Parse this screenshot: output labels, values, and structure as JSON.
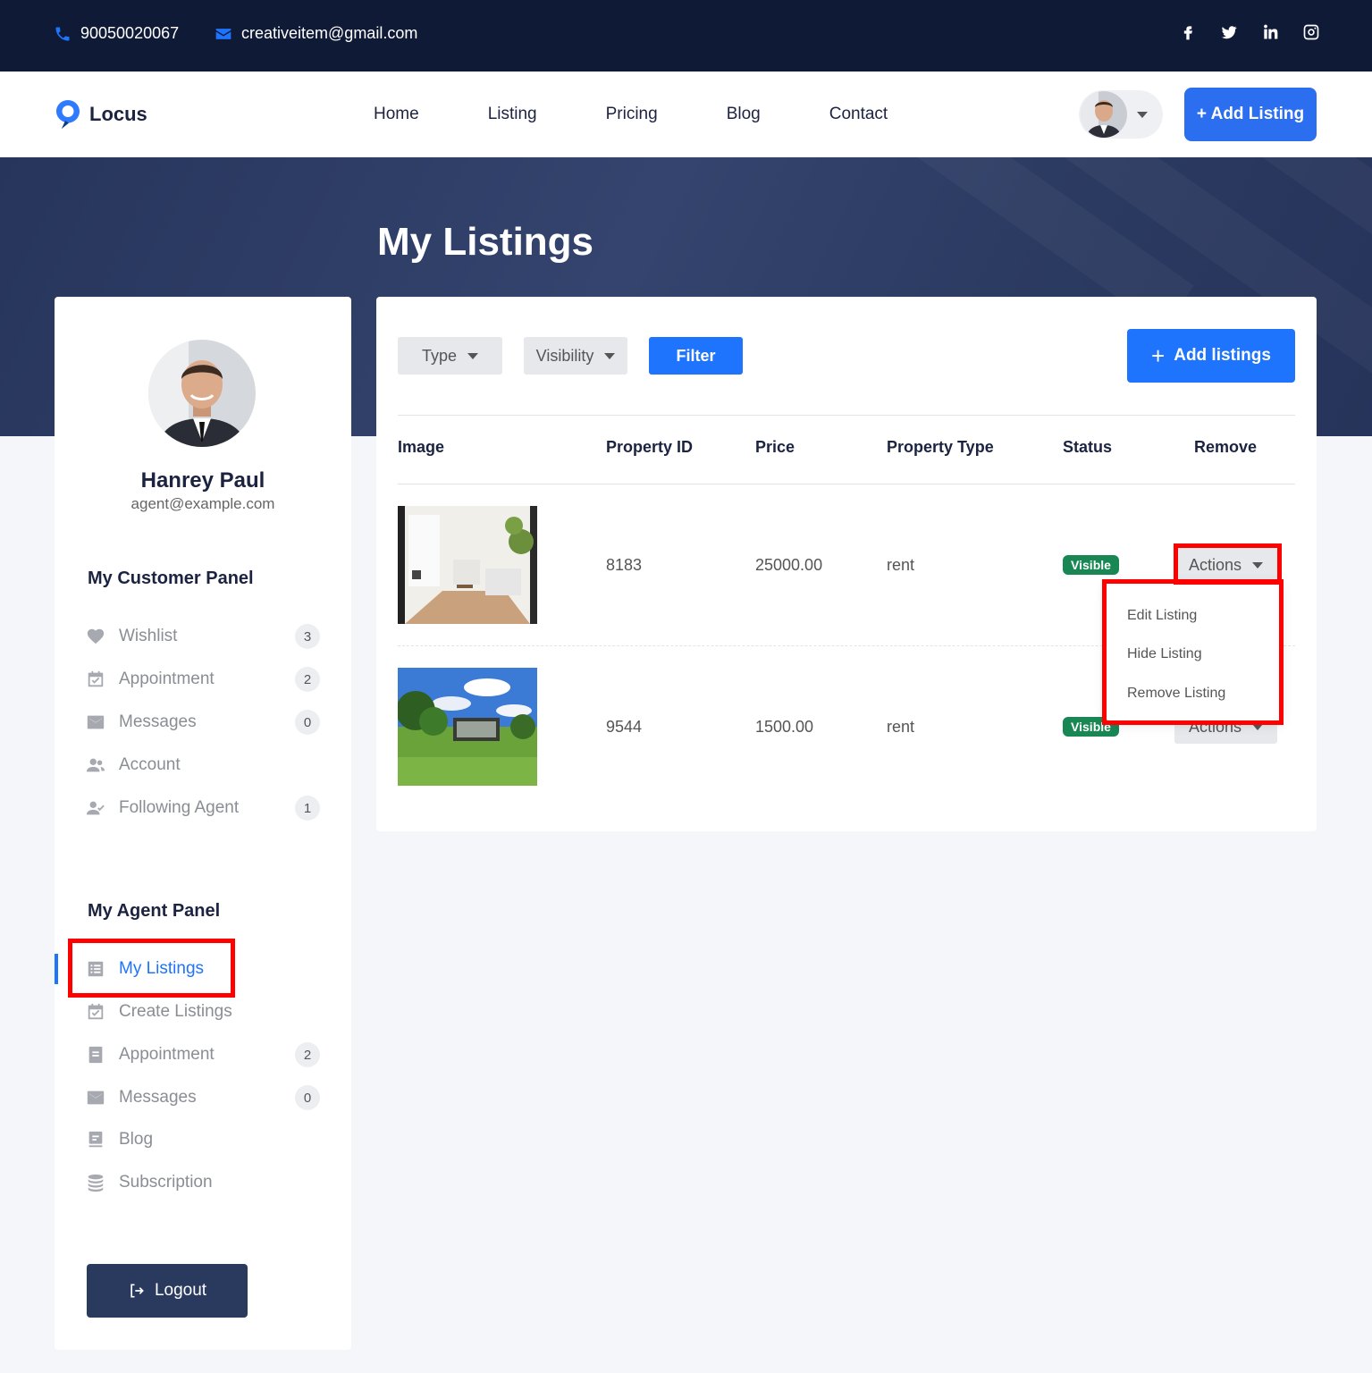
{
  "topbar": {
    "phone": "90050020067",
    "email": "creativeitem@gmail.com",
    "social": [
      "facebook-icon",
      "twitter-icon",
      "linkedin-icon",
      "instagram-icon"
    ]
  },
  "nav": {
    "brand": "Locus",
    "menu": [
      "Home",
      "Listing",
      "Pricing",
      "Blog",
      "Contact"
    ],
    "add_listing": "+ Add Listing"
  },
  "hero": {
    "title": "My Listings"
  },
  "profile": {
    "name": "Hanrey Paul",
    "email": "agent@example.com"
  },
  "customer_panel": {
    "title": "My Customer Panel",
    "items": [
      {
        "label": "Wishlist",
        "count": "3",
        "icon": "heart-icon"
      },
      {
        "label": "Appointment",
        "count": "2",
        "icon": "calendar-check-icon"
      },
      {
        "label": "Messages",
        "count": "0",
        "icon": "envelope-icon"
      },
      {
        "label": "Account",
        "icon": "users-icon"
      },
      {
        "label": "Following Agent",
        "count": "1",
        "icon": "user-check-icon"
      }
    ]
  },
  "agent_panel": {
    "title": "My Agent Panel",
    "items": [
      {
        "label": "My Listings",
        "icon": "list-icon",
        "active": true
      },
      {
        "label": "Create Listings",
        "icon": "calendar-check-icon"
      },
      {
        "label": "Appointment",
        "count": "2",
        "icon": "file-text-icon"
      },
      {
        "label": "Messages",
        "count": "0",
        "icon": "envelope-icon"
      },
      {
        "label": "Blog",
        "icon": "blog-icon"
      },
      {
        "label": "Subscription",
        "icon": "coins-icon"
      }
    ]
  },
  "logout": "Logout",
  "filters": {
    "type": "Type",
    "visibility": "Visibility",
    "filter": "Filter",
    "add_listings": "Add listings"
  },
  "table": {
    "headers": [
      "Image",
      "Property ID",
      "Price",
      "Property Type",
      "Status",
      "Remove"
    ],
    "rows": [
      {
        "id": "8183",
        "price": "25000.00",
        "type": "rent",
        "status": "Visible",
        "action": "Actions"
      },
      {
        "id": "9544",
        "price": "1500.00",
        "type": "rent",
        "status": "Visible",
        "action": "Actions"
      }
    ]
  },
  "dropdown": {
    "items": [
      "Edit Listing",
      "Hide Listing",
      "Remove Listing"
    ]
  },
  "colors": {
    "primary": "#1e74fd",
    "topbar": "#0f1a36",
    "hero": "#2f3f66",
    "badge": "#198754",
    "highlight": "#ff0000"
  }
}
